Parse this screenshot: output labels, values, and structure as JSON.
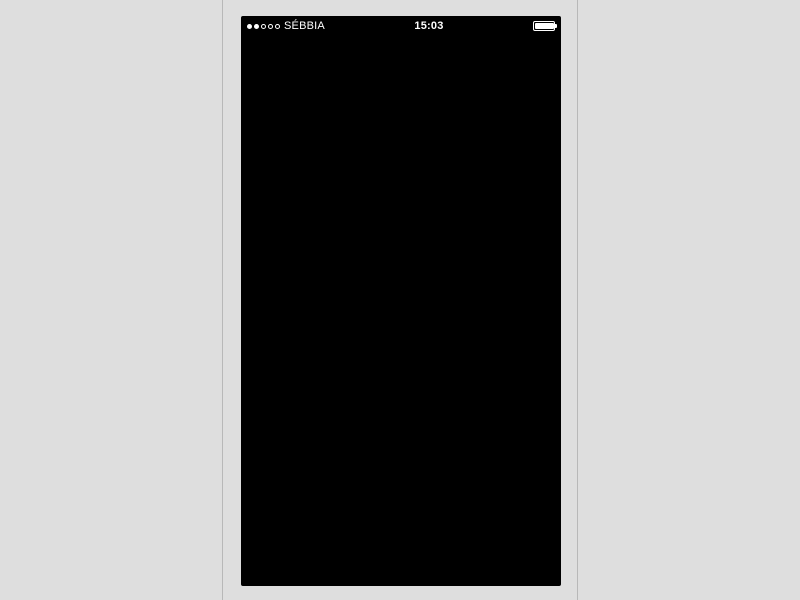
{
  "status_bar": {
    "carrier": "SÉBBIA",
    "time": "15:03",
    "signal_strength": 2,
    "signal_total": 5,
    "battery_percent": 95
  }
}
